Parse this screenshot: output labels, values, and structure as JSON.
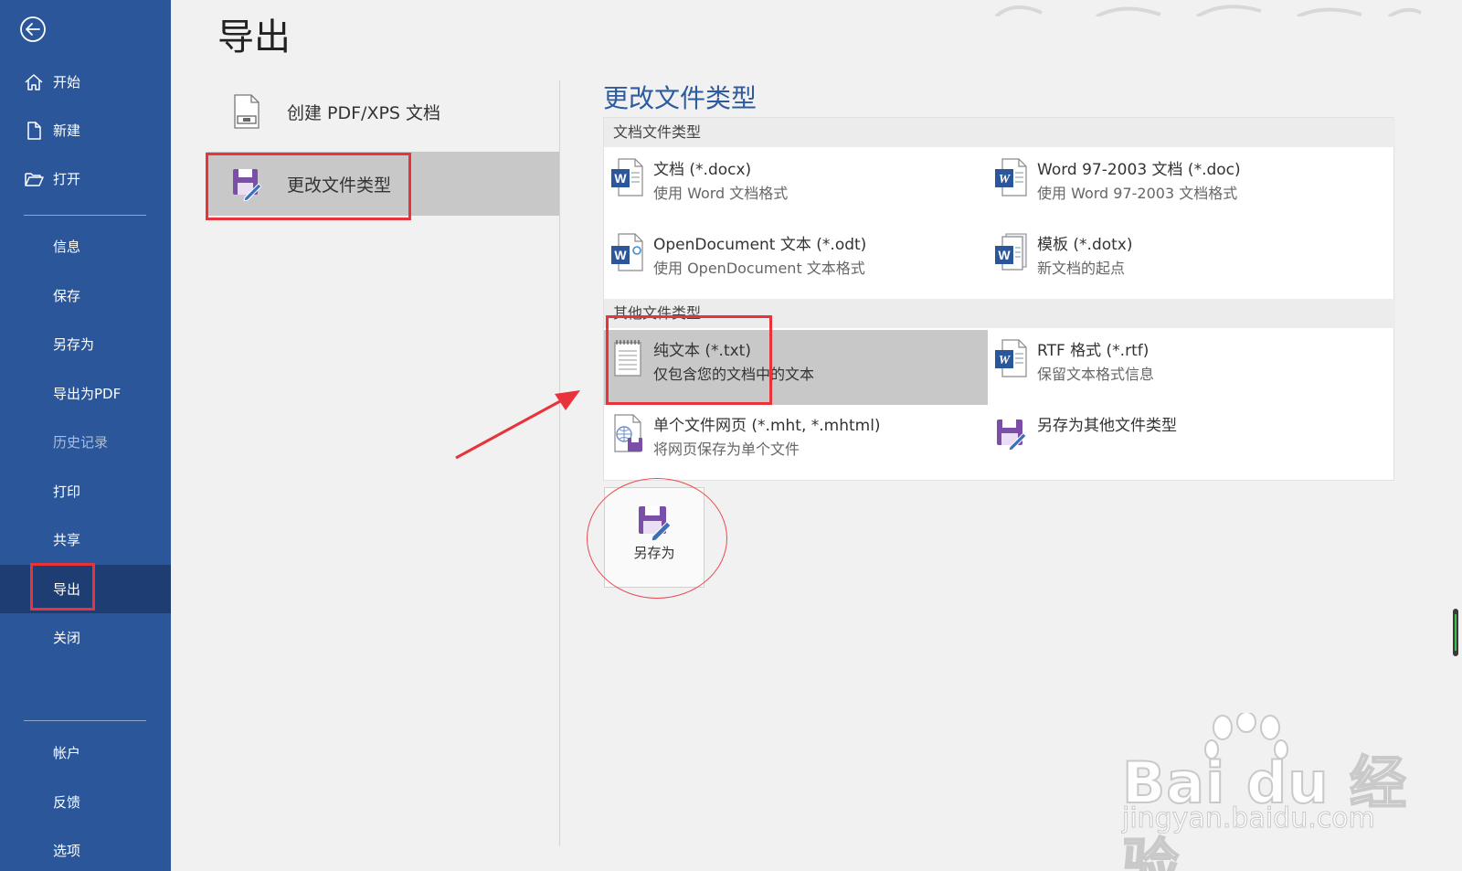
{
  "sidebar": {
    "items": [
      {
        "label": "开始",
        "icon": "home-icon"
      },
      {
        "label": "新建",
        "icon": "new-document-icon"
      },
      {
        "label": "打开",
        "icon": "open-folder-icon"
      },
      {
        "label": "信息"
      },
      {
        "label": "保存"
      },
      {
        "label": "另存为"
      },
      {
        "label": "导出为PDF"
      },
      {
        "label": "历史记录",
        "disabled": true
      },
      {
        "label": "打印"
      },
      {
        "label": "共享"
      },
      {
        "label": "导出",
        "active": true
      },
      {
        "label": "关闭"
      },
      {
        "label": "帐户"
      },
      {
        "label": "反馈"
      },
      {
        "label": "选项"
      }
    ]
  },
  "page": {
    "title": "导出"
  },
  "export_options": [
    {
      "label": "创建 PDF/XPS 文档",
      "icon": "pdf-document-icon"
    },
    {
      "label": "更改文件类型",
      "icon": "save-as-icon",
      "selected": true
    }
  ],
  "change_type": {
    "heading": "更改文件类型",
    "groups": [
      {
        "title": "文档文件类型",
        "items": [
          {
            "name": "文档 (*.docx)",
            "desc": "使用 Word 文档格式",
            "icon": "word-docx-icon"
          },
          {
            "name": "Word 97-2003 文档 (*.doc)",
            "desc": "使用 Word 97-2003 文档格式",
            "icon": "word-doc-icon"
          },
          {
            "name": "OpenDocument 文本 (*.odt)",
            "desc": "使用 OpenDocument 文本格式",
            "icon": "word-odt-icon"
          },
          {
            "name": "模板 (*.dotx)",
            "desc": "新文档的起点",
            "icon": "word-template-icon"
          }
        ]
      },
      {
        "title": "其他文件类型",
        "items": [
          {
            "name": "纯文本 (*.txt)",
            "desc": "仅包含您的文档中的文本",
            "icon": "plain-text-icon",
            "selected": true
          },
          {
            "name": "RTF 格式 (*.rtf)",
            "desc": "保留文本格式信息",
            "icon": "word-rtf-icon"
          },
          {
            "name": "单个文件网页 (*.mht, *.mhtml)",
            "desc": "将网页保存为单个文件",
            "icon": "web-page-icon"
          },
          {
            "name": "另存为其他文件类型",
            "desc": "",
            "icon": "save-as-icon"
          }
        ]
      }
    ],
    "save_as_button": {
      "label": "另存为"
    }
  },
  "watermark": {
    "brand": "Bai du 经验",
    "url": "jingyan.baidu.com"
  },
  "colors": {
    "sidebar": "#2b579a",
    "sidebar_active": "#1d3d73",
    "accent_heading": "#2e5a9e",
    "highlight": "#e8333a",
    "selected": "#c8c8c8",
    "word_blue": "#2b579a",
    "save_purple": "#7b4fa8"
  }
}
